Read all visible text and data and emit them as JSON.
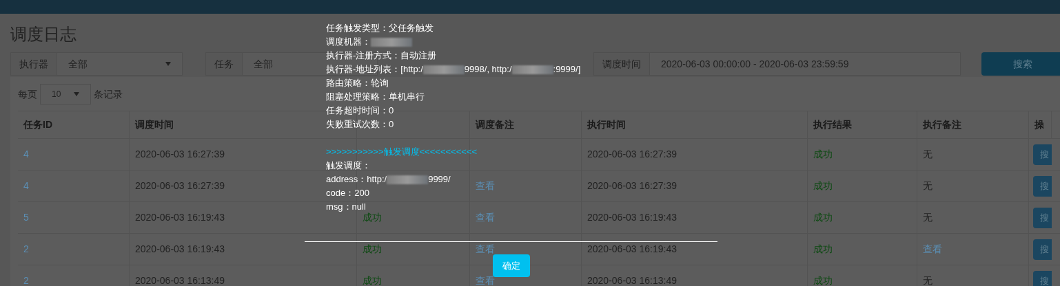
{
  "page_title": "调度日志",
  "filters": [
    {
      "label": "执行器",
      "value": "全部",
      "dropdown": true
    },
    {
      "label": "任务",
      "value": "全部",
      "dropdown": false
    },
    {
      "label": "调度时间",
      "value": "2020-06-03 00:00:00 - 2020-06-03 23:59:59",
      "dropdown": false
    }
  ],
  "search_button": "搜索",
  "page_size": {
    "prefix": "每页",
    "value": "10",
    "suffix": "条记录"
  },
  "table": {
    "columns": [
      "任务ID",
      "调度时间",
      "",
      "调度备注",
      "执行时间",
      "执行结果",
      "执行备注",
      "操"
    ],
    "rows": [
      {
        "cells": [
          "4",
          "2020-06-03 16:27:39",
          "",
          "",
          "2020-06-03 16:27:39",
          "成功",
          "无"
        ],
        "action": "搜"
      },
      {
        "cells": [
          "4",
          "2020-06-03 16:27:39",
          "",
          "查看",
          "2020-06-03 16:27:39",
          "成功",
          "无"
        ],
        "action": "搜"
      },
      {
        "cells": [
          "5",
          "2020-06-03 16:19:43",
          "成功",
          "查看",
          "2020-06-03 16:19:43",
          "成功",
          "无"
        ],
        "action": "搜"
      },
      {
        "cells": [
          "2",
          "2020-06-03 16:19:43",
          "成功",
          "查看",
          "2020-06-03 16:19:43",
          "成功",
          "查看"
        ],
        "action": "搜"
      },
      {
        "cells": [
          "2",
          "2020-06-03 16:13:49",
          "成功",
          "查看",
          "2020-06-03 16:13:49",
          "成功",
          "无"
        ],
        "action": "搜"
      }
    ]
  },
  "popup": {
    "lines": [
      {
        "kind": "text",
        "parts": [
          {
            "kind": "text",
            "text": "任务触发类型：父任务触发"
          }
        ]
      },
      {
        "kind": "text",
        "parts": [
          {
            "kind": "text",
            "text": "调度机器："
          },
          {
            "kind": "blur"
          }
        ]
      },
      {
        "kind": "text",
        "parts": [
          {
            "kind": "text",
            "text": "执行器-注册方式：自动注册"
          }
        ]
      },
      {
        "kind": "text",
        "parts": [
          {
            "kind": "text",
            "text": "执行器-地址列表：[http:/"
          },
          {
            "kind": "blur"
          },
          {
            "kind": "text",
            "text": "9998/, http:/"
          },
          {
            "kind": "blur"
          },
          {
            "kind": "text",
            "text": ":9999/]"
          }
        ]
      },
      {
        "kind": "text",
        "parts": [
          {
            "kind": "text",
            "text": "路由策略：轮询"
          }
        ]
      },
      {
        "kind": "text",
        "parts": [
          {
            "kind": "text",
            "text": "阻塞处理策略：单机串行"
          }
        ]
      },
      {
        "kind": "text",
        "parts": [
          {
            "kind": "text",
            "text": "任务超时时间：0"
          }
        ]
      },
      {
        "kind": "text",
        "parts": [
          {
            "kind": "text",
            "text": "失败重试次数：0"
          }
        ]
      },
      {
        "kind": "blank"
      },
      {
        "kind": "heading",
        "parts": [
          ">>>>>>>>>>>触发调度<<<<<<<<<<<"
        ]
      },
      {
        "kind": "text",
        "parts": [
          {
            "kind": "text",
            "text": "触发调度："
          }
        ]
      },
      {
        "kind": "text",
        "parts": [
          {
            "kind": "text",
            "text": "address：http:/"
          },
          {
            "kind": "blur"
          },
          {
            "kind": "text",
            "text": "9999/"
          }
        ]
      },
      {
        "kind": "text",
        "parts": [
          {
            "kind": "text",
            "text": "code：200"
          }
        ]
      },
      {
        "kind": "text",
        "parts": [
          {
            "kind": "text",
            "text": "msg：null"
          }
        ]
      }
    ],
    "confirm_button": "确定"
  }
}
